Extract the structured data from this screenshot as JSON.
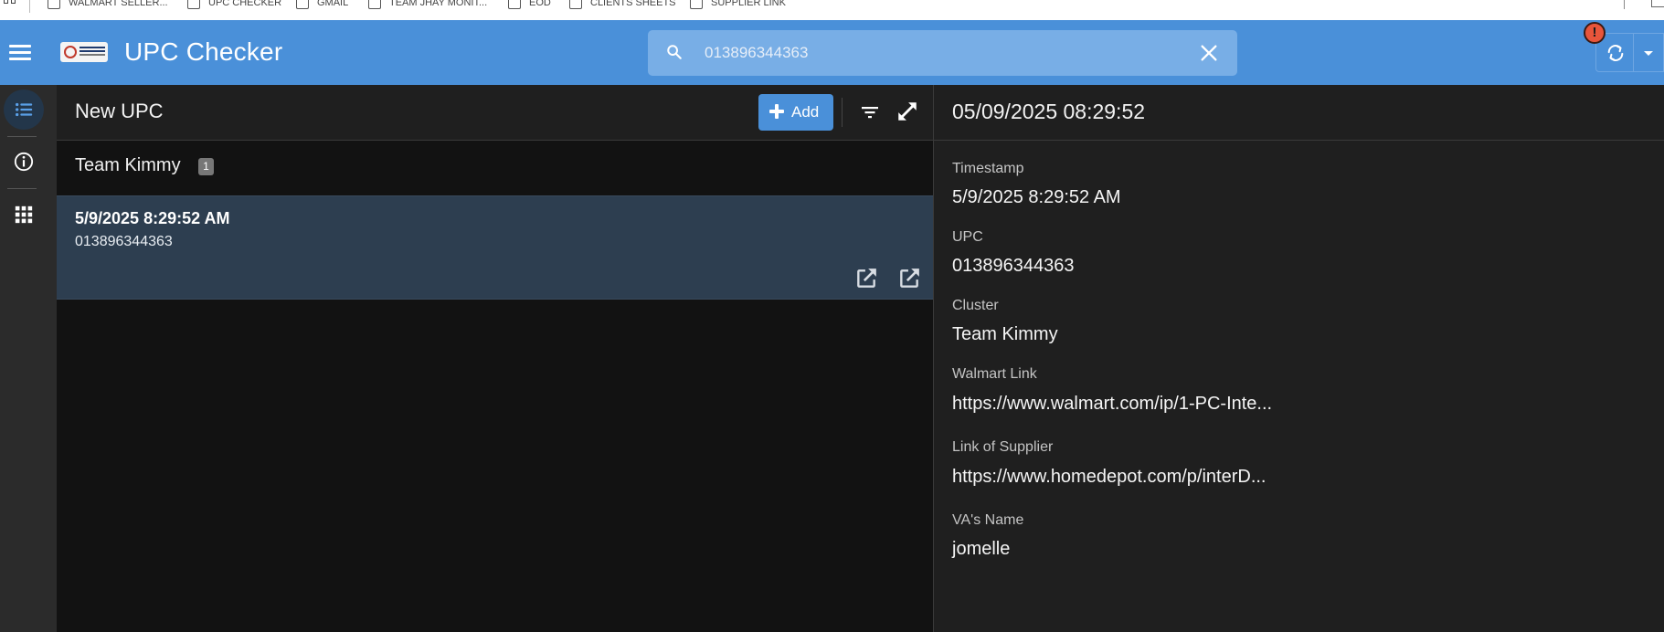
{
  "bookmarks": {
    "items": [
      {
        "label": "WALMART SELLER..."
      },
      {
        "label": "UPC CHECKER"
      },
      {
        "label": "GMAIL"
      },
      {
        "label": "TEAM JHAY MONIT..."
      },
      {
        "label": "EOD"
      },
      {
        "label": "CLIENTS SHEETS"
      },
      {
        "label": "SUPPLIER LINK"
      }
    ]
  },
  "header": {
    "title": "UPC Checker",
    "search_value": "013896344363",
    "alert_badge": "!",
    "accent_color": "#4a90d9"
  },
  "rail": {
    "items": [
      {
        "icon": "list-icon",
        "active": true
      },
      {
        "icon": "info-icon",
        "active": false
      },
      {
        "icon": "grid-icon",
        "active": false
      }
    ]
  },
  "list": {
    "view_title": "New UPC",
    "add_label": "Add",
    "group": {
      "name": "Team Kimmy",
      "count": "1"
    },
    "rows": [
      {
        "timestamp": "5/9/2025 8:29:52 AM",
        "upc": "013896344363"
      }
    ]
  },
  "detail": {
    "title": "05/09/2025 08:29:52",
    "fields": [
      {
        "label": "Timestamp",
        "value": "5/9/2025 8:29:52 AM"
      },
      {
        "label": "UPC",
        "value": "013896344363"
      },
      {
        "label": "Cluster",
        "value": "Team Kimmy"
      },
      {
        "label": "Walmart Link",
        "value": "https://www.walmart.com/ip/1-PC-Inte..."
      },
      {
        "label": "Link of Supplier",
        "value": "https://www.homedepot.com/p/interD..."
      },
      {
        "label": "VA's Name",
        "value": "jomelle"
      }
    ]
  }
}
